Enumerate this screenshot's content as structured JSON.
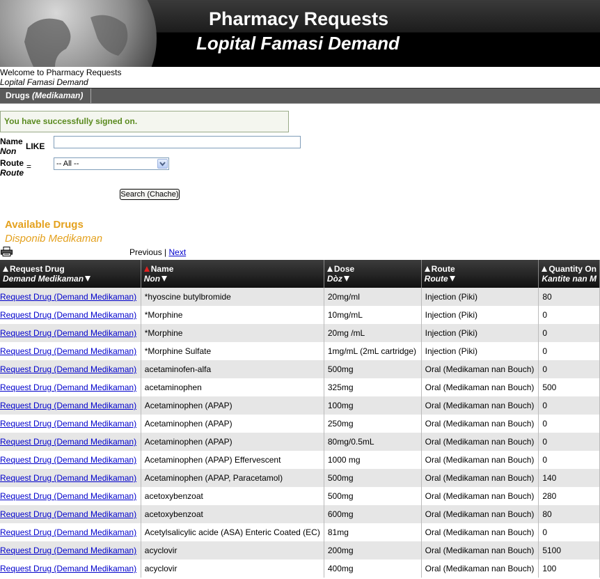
{
  "header": {
    "title": "Pharmacy Requests",
    "subtitle": "Lopital Famasi Demand"
  },
  "welcome": {
    "line1": "Welcome to Pharmacy Requests",
    "line2": "Lopital Famasi Demand"
  },
  "tabs": [
    {
      "label": "Drugs",
      "label_alt": "(Medikaman)"
    }
  ],
  "message": "You have successfully signed on.",
  "search": {
    "name_label": "Name",
    "name_label_alt": "Non",
    "name_op": "LIKE",
    "name_value": "",
    "route_label": "Route",
    "route_label_alt": "Route",
    "route_op": "=",
    "route_selected": "-- All --",
    "button_label": "Search (Chache)"
  },
  "results": {
    "title": "Available Drugs",
    "title_alt": "Disponib Medikaman",
    "prev_label": "Previous",
    "separator": "|",
    "next_label": "Next",
    "columns": [
      {
        "label": "Request Drug",
        "label_alt": "Demand Medikaman"
      },
      {
        "label": "Name",
        "label_alt": "Non"
      },
      {
        "label": "Dose",
        "label_alt": "Dòz"
      },
      {
        "label": "Route",
        "label_alt": "Route"
      },
      {
        "label": "Quantity On",
        "label_alt": "Kantite nan M"
      }
    ],
    "request_link": "Request Drug (Demand Medikaman)",
    "rows": [
      {
        "name": "*hyoscine butylbromide",
        "dose": "20mg/ml",
        "route": "Injection (Piki)",
        "qty": "80"
      },
      {
        "name": "*Morphine",
        "dose": "10mg/mL",
        "route": "Injection (Piki)",
        "qty": "0"
      },
      {
        "name": "*Morphine",
        "dose": "20mg /mL",
        "route": "Injection (Piki)",
        "qty": "0"
      },
      {
        "name": "*Morphine Sulfate",
        "dose": "1mg/mL (2mL cartridge)",
        "route": "Injection (Piki)",
        "qty": "0"
      },
      {
        "name": "acetaminofen-alfa",
        "dose": "500mg",
        "route": "Oral (Medikaman nan Bouch)",
        "qty": "0"
      },
      {
        "name": "acetaminophen",
        "dose": "325mg",
        "route": "Oral (Medikaman nan Bouch)",
        "qty": "500"
      },
      {
        "name": "Acetaminophen (APAP)",
        "dose": "100mg",
        "route": "Oral (Medikaman nan Bouch)",
        "qty": "0"
      },
      {
        "name": "Acetaminophen (APAP)",
        "dose": "250mg",
        "route": "Oral (Medikaman nan Bouch)",
        "qty": "0"
      },
      {
        "name": "Acetaminophen (APAP)",
        "dose": "80mg/0.5mL",
        "route": "Oral (Medikaman nan Bouch)",
        "qty": "0"
      },
      {
        "name": "Acetaminophen (APAP) Effervescent",
        "dose": "1000 mg",
        "route": "Oral (Medikaman nan Bouch)",
        "qty": "0"
      },
      {
        "name": "Acetaminophen (APAP, Paracetamol)",
        "dose": "500mg",
        "route": "Oral (Medikaman nan Bouch)",
        "qty": "140"
      },
      {
        "name": "acetoxybenzoat",
        "dose": "500mg",
        "route": "Oral (Medikaman nan Bouch)",
        "qty": "280"
      },
      {
        "name": "acetoxybenzoat",
        "dose": "600mg",
        "route": "Oral (Medikaman nan Bouch)",
        "qty": "80"
      },
      {
        "name": "Acetylsalicylic acide (ASA) Enteric Coated (EC)",
        "dose": "81mg",
        "route": "Oral (Medikaman nan Bouch)",
        "qty": "0"
      },
      {
        "name": "acyclovir",
        "dose": "200mg",
        "route": "Oral (Medikaman nan Bouch)",
        "qty": "5100"
      },
      {
        "name": "acyclovir",
        "dose": "400mg",
        "route": "Oral (Medikaman nan Bouch)",
        "qty": "100"
      }
    ]
  },
  "icons": {
    "print": "printer-icon",
    "sort_up": "sort-ascending-icon",
    "sort_down": "sort-descending-icon",
    "globe": "globe-icon"
  },
  "colors": {
    "accent": "#e4a11e",
    "success": "#5a8a1f",
    "link": "#0000cc",
    "active_sort": "#e02020"
  }
}
